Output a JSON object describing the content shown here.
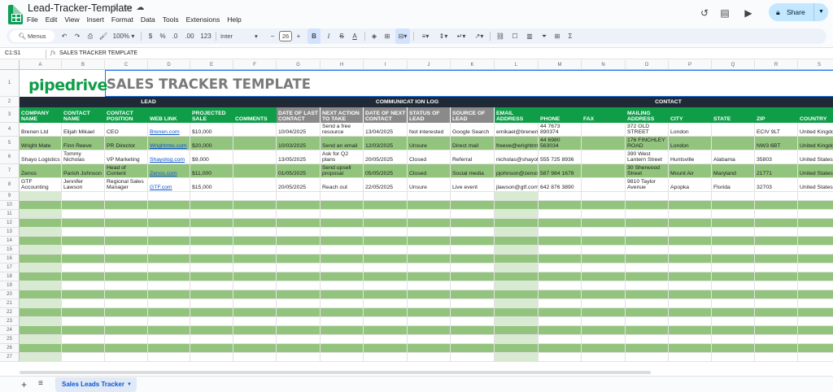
{
  "app": {
    "doc_title": "Lead-Tracker-Template",
    "menus": [
      "File",
      "Edit",
      "View",
      "Insert",
      "Format",
      "Data",
      "Tools",
      "Extensions",
      "Help"
    ],
    "share_label": "Share"
  },
  "toolbar": {
    "menus_label": "Menus",
    "zoom": "100%",
    "currency": "$",
    "percent": "%",
    "dec_less": ".0",
    "dec_more": ".00",
    "number_format": "123",
    "font": "Inter",
    "font_size": "26",
    "bold": "B",
    "italic": "I",
    "strike": "S",
    "text_color": "A"
  },
  "formula_bar": {
    "name_box": "C1:S1",
    "fx": "fx",
    "content": "SALES TRACKER TEMPLATE"
  },
  "columns": [
    "A",
    "B",
    "C",
    "D",
    "E",
    "F",
    "G",
    "H",
    "I",
    "J",
    "K",
    "L",
    "M",
    "N",
    "O",
    "P",
    "Q",
    "R",
    "S"
  ],
  "rows": [
    "1",
    "2",
    "3",
    "4",
    "5",
    "6",
    "7",
    "8",
    "9",
    "10",
    "11",
    "12",
    "13",
    "14",
    "15",
    "16",
    "17",
    "18",
    "19",
    "20",
    "21",
    "22",
    "23",
    "24",
    "25",
    "26",
    "27"
  ],
  "banner": {
    "logo": "pipedrive",
    "title": "SALES TRACKER TEMPLATE"
  },
  "groups": {
    "lead": "LEAD",
    "comm": "COMMUNICAT ION LOG",
    "contact": "CONTACT"
  },
  "headers": [
    "COMPANY NAME",
    "CONTACT NAME",
    "CONTACT POSITION",
    "WEB LINK",
    "PROJECTED SALE",
    "COMMENTS",
    "DATE OF LAST CONTACT",
    "NEXT ACTION TO TAKE",
    "DATE OF NEXT CONTACT",
    "STATUS OF LEAD",
    "SOURCE OF LEAD",
    "EMAIL ADDRESS",
    "PHONE",
    "FAX",
    "MAILING ADDRESS",
    "CITY",
    "STATE",
    "ZIP",
    "COUNTRY"
  ],
  "data_rows": [
    [
      "Brenen Ltd",
      "Elijah Mikael",
      "CEO",
      "Brenen.com",
      "$10,000",
      "",
      "10/04/2025",
      "Send a free resource",
      "13/04/2025",
      "Not interested",
      "Google Search",
      "emikael@brenen.com",
      "44 7673 890374",
      "",
      "372 OLD STREET",
      "London",
      "",
      "ECIV 9LT",
      "United Kingdom"
    ],
    [
      "Wright Mate",
      "Finn Reeve",
      "PR Director",
      "Wrightmte.com",
      "$20,000",
      "",
      "10/03/2025",
      "Send an email",
      "12/03/2025",
      "Unsure",
      "Direct mail",
      "freeve@wrightmte.com",
      "44 6980 563034",
      "",
      "176 FINCHLEY ROAD",
      "London",
      "",
      "NW3 6BT",
      "United Kingdom"
    ],
    [
      "Shayo Logistics",
      "Tommy Nicholas",
      "VP Marketing",
      "Shayolog.com",
      "$9,000",
      "",
      "13/05/2025",
      "Ask for Q2 plans",
      "20/05/2025",
      "Closed",
      "Referral",
      "nicholas@shayolog.com",
      "555 725 8936",
      "",
      "390 West Lantern Street",
      "Huntsville",
      "Alabama",
      "35803",
      "United States"
    ],
    [
      "Zenos",
      "Parish Johnson",
      "Head of Content",
      "Zenos.com",
      "$11,000",
      "",
      "01/05/2025",
      "Send upsell proposal",
      "05/05/2025",
      "Closed",
      "Social media",
      "pjohnson@zenos.com",
      "587 984 1678",
      "",
      "30 Sherwood Street",
      "Mount Air",
      "Maryland",
      "21771",
      "United States"
    ],
    [
      "GTF Accounting",
      "Jennifer Lawson",
      "Regional Sales Manager",
      "GTF.com",
      "$15,000",
      "",
      "20/05/2025",
      "Reach out",
      "22/05/2025",
      "Unsure",
      "Live event",
      "jlawson@gtf.com",
      "642 876 3890",
      "",
      "9810 Taylor Avenue",
      "Apopka",
      "Florida",
      "32703",
      "United States"
    ]
  ],
  "sheet_tab": "Sales Leads Tracker",
  "colors": {
    "green": "#0f9d48",
    "dark": "#1f2a36",
    "band": "#93c47d",
    "share": "#c2e7ff"
  }
}
